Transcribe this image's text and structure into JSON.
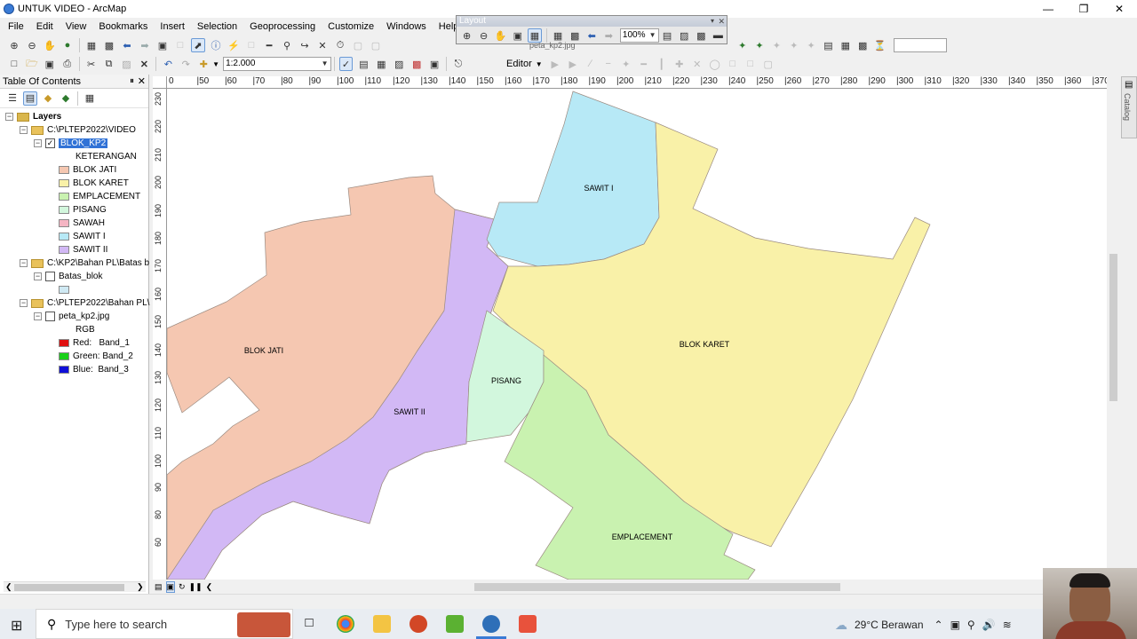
{
  "window": {
    "title": "UNTUK VIDEO - ArcMap"
  },
  "menu": [
    "File",
    "Edit",
    "View",
    "Bookmarks",
    "Insert",
    "Selection",
    "Geoprocessing",
    "Customize",
    "Windows",
    "Help"
  ],
  "standard_toolbar": {
    "scale": "1:2.000",
    "editor_label": "Editor"
  },
  "layout_toolbar": {
    "title": "Layout",
    "zoom": "100%",
    "overlay_text": "peta_kp2.jpg"
  },
  "toc": {
    "title": "Table Of Contents",
    "root": "Layers",
    "groups": [
      {
        "path": "C:\\PLTEP2022\\VIDEO",
        "layer": "BLOK_KP2",
        "checked": true,
        "field": "KETERANGAN",
        "classes": [
          {
            "label": "BLOK JATI",
            "color": "#f5c7b1"
          },
          {
            "label": "BLOK KARET",
            "color": "#f9f1a8"
          },
          {
            "label": "EMPLACEMENT",
            "color": "#c9f2b0"
          },
          {
            "label": "PISANG",
            "color": "#d2f7dd"
          },
          {
            "label": "SAWAH",
            "color": "#f5b5c3"
          },
          {
            "label": "SAWIT I",
            "color": "#b7e9f6"
          },
          {
            "label": "SAWIT II",
            "color": "#d2b8f5"
          }
        ]
      },
      {
        "path": "C:\\KP2\\Bahan PL\\Batas b",
        "layer": "Batas_blok",
        "checked": false,
        "classes": [
          {
            "label": "",
            "color": "#cfe9f3"
          }
        ]
      },
      {
        "path": "C:\\PLTEP2022\\Bahan PL\\",
        "layer": "peta_kp2.jpg",
        "checked": false,
        "field": "RGB",
        "classes": [
          {
            "label": "Red:   Band_1",
            "color": "#e01010"
          },
          {
            "label": "Green: Band_2",
            "color": "#18d018"
          },
          {
            "label": "Blue:  Band_3",
            "color": "#1010d8"
          }
        ]
      }
    ]
  },
  "ruler": {
    "top": [
      "0",
      "|50",
      "|60",
      "|70",
      "|80",
      "|90",
      "|100",
      "|110",
      "|120",
      "|130",
      "|140",
      "|150",
      "|160",
      "|170",
      "|180",
      "|190",
      "|200",
      "|210",
      "|220",
      "|230",
      "|240",
      "|250",
      "|260",
      "|270",
      "|280",
      "|290",
      "|300",
      "|310",
      "|320",
      "|330",
      "|340",
      "|350",
      "|360",
      "|370"
    ],
    "left": [
      "230",
      "220",
      "210",
      "200",
      "190",
      "180",
      "170",
      "160",
      "150",
      "140",
      "130",
      "120",
      "110",
      "100",
      "90",
      "80",
      "60"
    ]
  },
  "map_labels": {
    "blok_jati": "BLOK JATI",
    "sawit_i": "SAWIT I",
    "blok_karet": "BLOK KARET",
    "pisang": "PISANG",
    "sawit_ii": "SAWIT II",
    "emplacement": "EMPLACEMENT"
  },
  "catalog_label": "Catalog",
  "taskbar": {
    "search_placeholder": "Type here to search",
    "weather": "29°C Berawan"
  }
}
